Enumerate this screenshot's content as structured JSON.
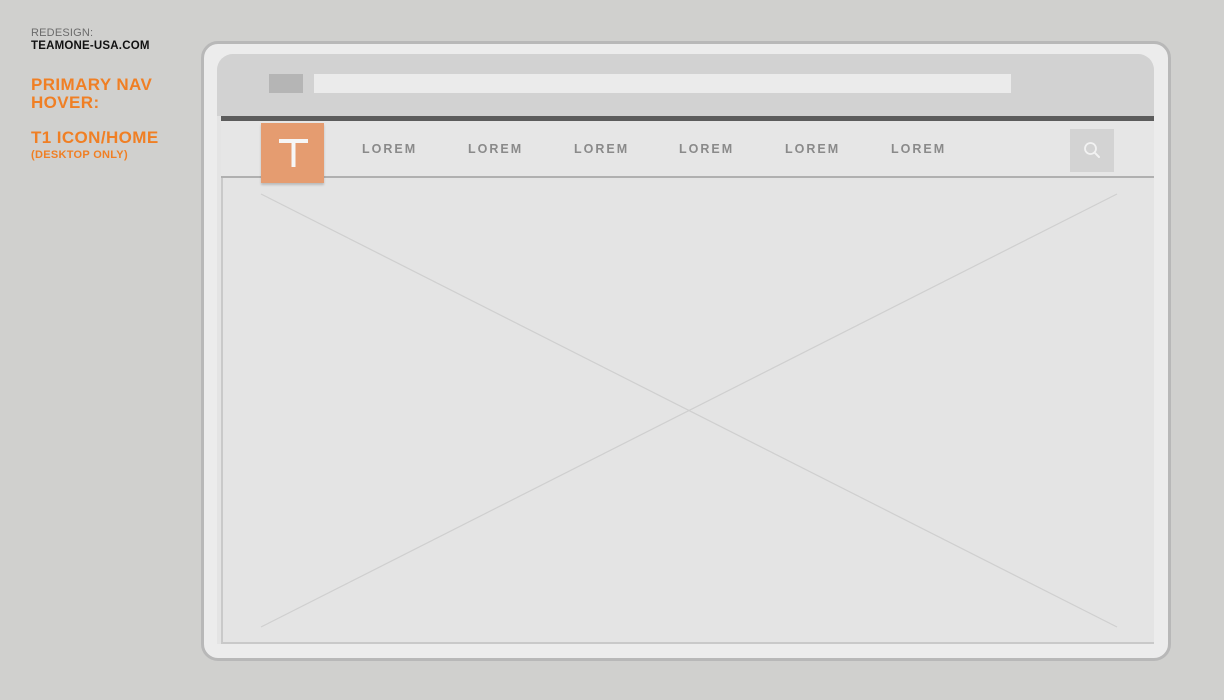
{
  "annotations": {
    "project_label": "REDESIGN:",
    "project_site": "TEAMONE-USA.COM",
    "state_line1": "PRIMARY NAV",
    "state_line2": "HOVER:",
    "element_title": "T1 ICON/HOME",
    "element_note": "(DESKTOP ONLY)"
  },
  "logo": {
    "glyph": "T"
  },
  "nav": {
    "items": [
      {
        "label": "LOREM"
      },
      {
        "label": "LOREM"
      },
      {
        "label": "LOREM"
      },
      {
        "label": "LOREM"
      },
      {
        "label": "LOREM"
      },
      {
        "label": "LOREM"
      }
    ]
  },
  "icons": {
    "search": "search-icon",
    "logo": "t1-logo-icon"
  },
  "colors": {
    "accent_orange": "#f07f24",
    "logo_hover_fill": "#e59c70",
    "nav_topline": "#5c5c5c",
    "background": "#d0d0ce"
  }
}
